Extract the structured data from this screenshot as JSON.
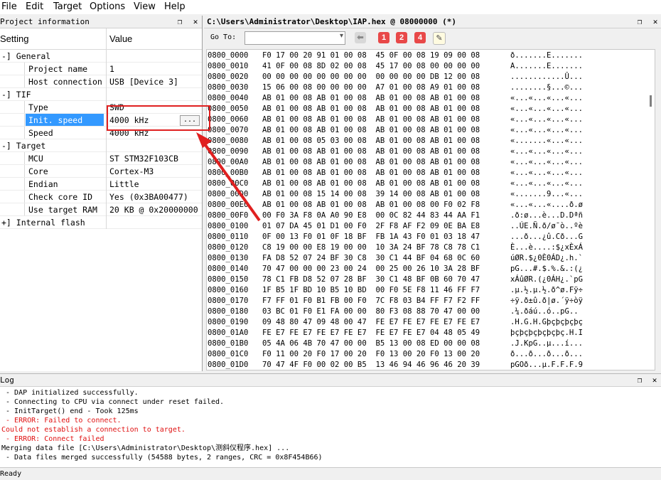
{
  "menu": [
    "File",
    "Edit",
    "Target",
    "Options",
    "View",
    "Help"
  ],
  "left_panel": {
    "title": "Project information",
    "header_setting": "Setting",
    "header_value": "Value",
    "rows": [
      {
        "label": "-] General",
        "value": "",
        "level": 0
      },
      {
        "label": "Project name",
        "value": "1",
        "level": 2
      },
      {
        "label": "Host connection",
        "value": "USB [Device 3]",
        "level": 2
      },
      {
        "label": "-] TIF",
        "value": "",
        "level": 0
      },
      {
        "label": "Type",
        "value": "SWD",
        "level": 2
      },
      {
        "label": "Init. speed",
        "value": "4000 kHz",
        "level": 2,
        "selected": true
      },
      {
        "label": "Speed",
        "value": "4000 kHz",
        "level": 2
      },
      {
        "label": "-] Target",
        "value": "",
        "level": 0
      },
      {
        "label": "MCU",
        "value": "ST STM32F103CB",
        "level": 2
      },
      {
        "label": "Core",
        "value": "Cortex-M3",
        "level": 2
      },
      {
        "label": "Endian",
        "value": "Little",
        "level": 2
      },
      {
        "label": "Check core ID",
        "value": "Yes (0x3BA00477)",
        "level": 2
      },
      {
        "label": "Use target RAM",
        "value": "20 KB @ 0x20000000",
        "level": 2
      },
      {
        "label": "+] Internal flash",
        "value": "",
        "level": 0
      }
    ],
    "ellipsis_label": "..."
  },
  "right_panel": {
    "title": "C:\\Users\\Administrator\\Desktop\\IAP.hex @ 08000000 (*)",
    "goto_label": "Go To:",
    "goto_value": "",
    "toolbar_buttons": [
      "1",
      "2",
      "4"
    ],
    "hex_rows": [
      {
        "addr": "0800_0000",
        "bytes": "F0 17 00 20 91 01 00 08  45 0F 00 08 19 09 00 08",
        "ascii": "ð.......E......."
      },
      {
        "addr": "0800_0010",
        "bytes": "41 0F 00 08 8D 02 00 08  45 17 00 08 00 00 00 00",
        "ascii": "A.......E......."
      },
      {
        "addr": "0800_0020",
        "bytes": "00 00 00 00 00 00 00 00  00 00 00 00 DB 12 00 08",
        "ascii": "............Û..."
      },
      {
        "addr": "0800_0030",
        "bytes": "15 06 00 08 00 00 00 00  A7 01 00 08 A9 01 00 08",
        "ascii": "........§...©..."
      },
      {
        "addr": "0800_0040",
        "bytes": "AB 01 00 08 AB 01 00 08  AB 01 00 08 AB 01 00 08",
        "ascii": "«...«...«...«..."
      },
      {
        "addr": "0800_0050",
        "bytes": "AB 01 00 08 AB 01 00 08  AB 01 00 08 AB 01 00 08",
        "ascii": "«...«...«...«..."
      },
      {
        "addr": "0800_0060",
        "bytes": "AB 01 00 08 AB 01 00 08  AB 01 00 08 AB 01 00 08",
        "ascii": "«...«...«...«..."
      },
      {
        "addr": "0800_0070",
        "bytes": "AB 01 00 08 AB 01 00 08  AB 01 00 08 AB 01 00 08",
        "ascii": "«...«...«...«..."
      },
      {
        "addr": "0800_0080",
        "bytes": "AB 01 00 08 05 03 00 08  AB 01 00 08 AB 01 00 08",
        "ascii": "«.......«...«..."
      },
      {
        "addr": "0800_0090",
        "bytes": "AB 01 00 08 AB 01 00 08  AB 01 00 08 AB 01 00 08",
        "ascii": "«...«...«...«..."
      },
      {
        "addr": "0800_00A0",
        "bytes": "AB 01 00 08 AB 01 00 08  AB 01 00 08 AB 01 00 08",
        "ascii": "«...«...«...«..."
      },
      {
        "addr": "0800_00B0",
        "bytes": "AB 01 00 08 AB 01 00 08  AB 01 00 08 AB 01 00 08",
        "ascii": "«...«...«...«..."
      },
      {
        "addr": "0800_00C0",
        "bytes": "AB 01 00 08 AB 01 00 08  AB 01 00 08 AB 01 00 08",
        "ascii": "«...«...«...«..."
      },
      {
        "addr": "0800_00D0",
        "bytes": "AB 01 00 08 15 14 00 08  39 14 00 08 AB 01 00 08",
        "ascii": "«.......9...«..."
      },
      {
        "addr": "0800_00E0",
        "bytes": "AB 01 00 08 AB 01 00 08  AB 01 00 08 00 F0 02 F8",
        "ascii": "«...«...«....ð.ø"
      },
      {
        "addr": "0800_00F0",
        "bytes": "00 F0 3A F8 0A A0 90 E8  00 0C 82 44 83 44 AA F1",
        "ascii": ".ð:ø...è...D.Dªñ"
      },
      {
        "addr": "0800_0100",
        "bytes": "01 07 DA 45 01 D1 00 F0  2F F8 AF F2 09 0E BA E8",
        "ascii": "..ÚE.Ñ.ð/ø¯ò..ºè"
      },
      {
        "addr": "0800_0110",
        "bytes": "0F 00 13 F0 01 0F 18 BF  FB 1A 43 F0 01 03 18 47",
        "ascii": "...ð...¿û.Cð...G"
      },
      {
        "addr": "0800_0120",
        "bytes": "C8 19 00 00 E8 19 00 00  10 3A 24 BF 78 C8 78 C1",
        "ascii": "È...è....:$¿xÈxÁ"
      },
      {
        "addr": "0800_0130",
        "bytes": "FA D8 52 07 24 BF 30 C8  30 C1 44 BF 04 68 0C 60",
        "ascii": "úØR.$¿0È0ÁD¿.h.`"
      },
      {
        "addr": "0800_0140",
        "bytes": "70 47 00 00 00 23 00 24  00 25 00 26 10 3A 28 BF",
        "ascii": "pG...#.$.%.&.:(¿"
      },
      {
        "addr": "0800_0150",
        "bytes": "78 C1 FB D8 52 07 28 BF  30 C1 48 BF 0B 60 70 47",
        "ascii": "xÁûØR.(¿0ÁH¿.`pG"
      },
      {
        "addr": "0800_0160",
        "bytes": "1F B5 1F BD 10 B5 10 BD  00 F0 5E F8 11 46 FF F7",
        "ascii": ".µ.½.µ.½.ð^ø.Fÿ÷"
      },
      {
        "addr": "0800_0170",
        "bytes": "F7 FF 01 F0 B1 FB 00 F0  7C F8 03 B4 FF F7 F2 FF",
        "ascii": "÷ÿ.ð±û.ð|ø.´ÿ÷òÿ"
      },
      {
        "addr": "0800_0180",
        "bytes": "03 BC 01 F0 E1 FA 00 00  80 F3 08 88 70 47 00 00",
        "ascii": ".¼.ðáú..ó..pG.."
      },
      {
        "addr": "0800_0190",
        "bytes": "09 48 80 47 09 48 00 47  FE E7 FE E7 FE E7 FE E7",
        "ascii": ".H.G.H.Gþçþçþçþç"
      },
      {
        "addr": "0800_01A0",
        "bytes": "FE E7 FE E7 FE E7 FE E7  FE E7 FE E7 04 48 05 49",
        "ascii": "þçþçþçþçþçþç.H.I"
      },
      {
        "addr": "0800_01B0",
        "bytes": "05 4A 06 4B 70 47 00 00  B5 13 00 08 ED 00 00 08",
        "ascii": ".J.KpG..µ...í..."
      },
      {
        "addr": "0800_01C0",
        "bytes": "F0 11 00 20 F0 17 00 20  F0 13 00 20 F0 13 00 20",
        "ascii": "ð...ð...ð...ð..."
      },
      {
        "addr": "0800_01D0",
        "bytes": "70 47 4F F0 00 02 00 B5  13 46 94 46 96 46 20 39",
        "ascii": "pGOð...µ.F.F.F.9"
      }
    ]
  },
  "log": {
    "title": "Log",
    "lines": [
      {
        "text": " - DAP initialized successfully.",
        "error": false
      },
      {
        "text": " - Connecting to CPU via connect under reset failed.",
        "error": false
      },
      {
        "text": " - InitTarget() end - Took 125ms",
        "error": false
      },
      {
        "text": " - ERROR: Failed to connect.",
        "error": true
      },
      {
        "text": "Could not establish a connection to target.",
        "error": true
      },
      {
        "text": " - ERROR: Connect failed",
        "error": true
      },
      {
        "text": "Merging data file [C:\\Users\\Administrator\\Desktop\\测斜仪程序.hex] ...",
        "error": false
      },
      {
        "text": " - Data files merged successfully (54588 bytes, 2 ranges, CRC = 0x8F454B66)",
        "error": false
      }
    ]
  },
  "status": "Ready",
  "colors": {
    "selection": "#3399ff",
    "annotation": "#e02020",
    "error_text": "#e01010",
    "toolbar_badge": "#e84848"
  },
  "icons": {
    "restore": "❐",
    "close": "✕",
    "back": "arrow-left-icon",
    "edit": "notepad-icon"
  }
}
